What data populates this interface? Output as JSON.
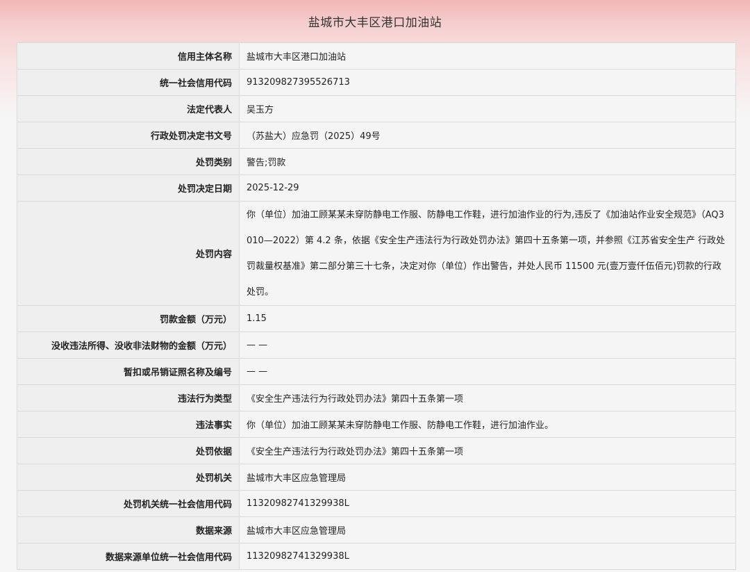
{
  "page": {
    "title": "盐城市大丰区港口加油站"
  },
  "rows": [
    {
      "label": "信用主体名称",
      "value": "盐城市大丰区港口加油站"
    },
    {
      "label": "统一社会信用代码",
      "value": "913209827395526713"
    },
    {
      "label": "法定代表人",
      "value": "吴玉方"
    },
    {
      "label": "行政处罚决定书文号",
      "value": "（苏盐大）应急罚（2025）49号"
    },
    {
      "label": "处罚类别",
      "value": "警告;罚款"
    },
    {
      "label": "处罚决定日期",
      "value": "2025-12-29"
    },
    {
      "label": "处罚内容",
      "value": "你（单位）加油工顾某某未穿防静电工作服、防静电工作鞋，进行加油作业的行为,违反了《加油站作业安全规范》（AQ3010—2022）第 4.2 条，依据《安全生产违法行为行政处罚办法》第四十五条第一项，并参照《江苏省安全生产 行政处罚裁量权基准》第二部分第三十七条，决定对你（单位）作出警告，并处人民币 11500 元(壹万壹仟伍佰元)罚款的行政处罚。"
    },
    {
      "label": "罚款金额（万元）",
      "value": "1.15"
    },
    {
      "label": "没收违法所得、没收非法财物的金额（万元）",
      "value": "— —"
    },
    {
      "label": "暂扣或吊销证照名称及编号",
      "value": "— —"
    },
    {
      "label": "违法行为类型",
      "value": "《安全生产违法行为行政处罚办法》第四十五条第一项"
    },
    {
      "label": "违法事实",
      "value": "你（单位）加油工顾某某未穿防静电工作服、防静电工作鞋，进行加油作业。"
    },
    {
      "label": "处罚依据",
      "value": "《安全生产违法行为行政处罚办法》第四十五条第一项"
    },
    {
      "label": "处罚机关",
      "value": "盐城市大丰区应急管理局"
    },
    {
      "label": "处罚机关统一社会信用代码",
      "value": "11320982741329938L"
    },
    {
      "label": "数据来源",
      "value": "盐城市大丰区应急管理局"
    },
    {
      "label": "数据来源单位统一社会信用代码",
      "value": "11320982741329938L"
    }
  ]
}
